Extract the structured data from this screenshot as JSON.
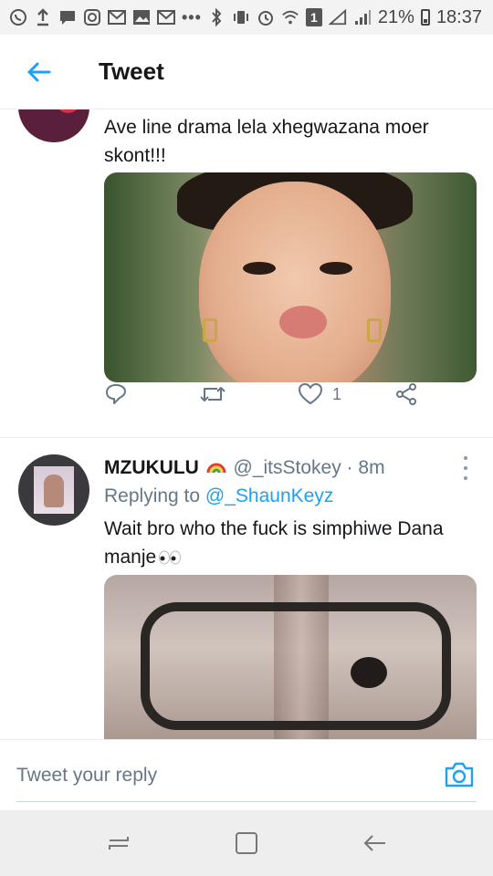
{
  "status_bar": {
    "battery": "21%",
    "time": "18:37",
    "sim_badge": "1",
    "notification_dots": "•••"
  },
  "header": {
    "title": "Tweet"
  },
  "tweets": [
    {
      "text": "Ave line drama lela xhegwazana moer skont!!!",
      "like_count": "1"
    },
    {
      "author_name": "MZUKULU",
      "handle": "@_itsStokey",
      "separator": "·",
      "time": "8m",
      "replying_label": "Replying to",
      "replying_handle": "@_ShaunKeyz",
      "text": "Wait bro who the fuck is simphiwe Dana manje"
    }
  ],
  "composer": {
    "placeholder": "Tweet your reply"
  },
  "colors": {
    "accent": "#1da1f2",
    "secondary_text": "#657786",
    "primary_text": "#14171a"
  },
  "icons": {
    "back": "arrow-left-icon",
    "reply": "reply-icon",
    "retweet": "retweet-icon",
    "like": "heart-icon",
    "share": "share-icon",
    "more": "more-vertical-icon",
    "camera": "camera-icon"
  }
}
